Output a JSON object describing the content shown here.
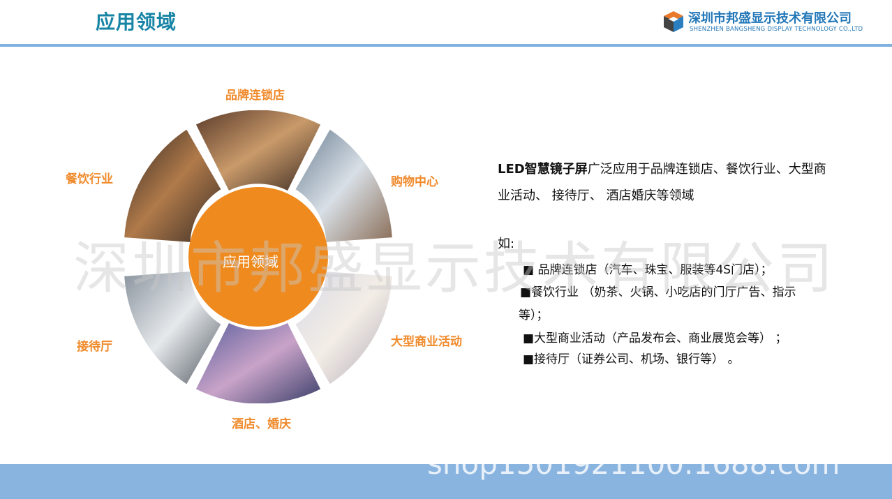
{
  "header": {
    "title": "应用领域",
    "company_cn": "深圳市邦盛显示技术有限公司",
    "company_en": "SHENZHEN BANGSHENG DISPLAY TECHNOLOGY CO.,LTD"
  },
  "wheel": {
    "center": "应用领域",
    "labels": {
      "top": "品牌连锁店",
      "top_right": "购物中心",
      "bottom_right": "大型商业活动",
      "bottom": "酒店、婚庆",
      "bottom_left": "接待厅",
      "top_left": "餐饮行业"
    },
    "colors": {
      "accent": "#f08a2b",
      "center": "#ef8a1f"
    }
  },
  "content": {
    "desc_bold": "LED智慧镜子屏",
    "desc_rest": "广泛应用于品牌连锁店、餐饮行业、大型商业活动、 接待厅、 酒店婚庆等领域",
    "ru": "如:",
    "items": [
      "■ 品牌连锁店（汽车、珠宝、服装等4S门店）；",
      "■餐饮行业 （奶茶、火锅、小吃店的门厅广告、指示",
      "等）；",
      "■大型商业活动（产品发布会、商业展览会等） ；",
      "■接待厅（证券公司、机场、银行等） 。"
    ]
  },
  "watermark": "深圳市邦盛显示技术有限公司",
  "footer_watermark": "shop1501921100.1688.com"
}
